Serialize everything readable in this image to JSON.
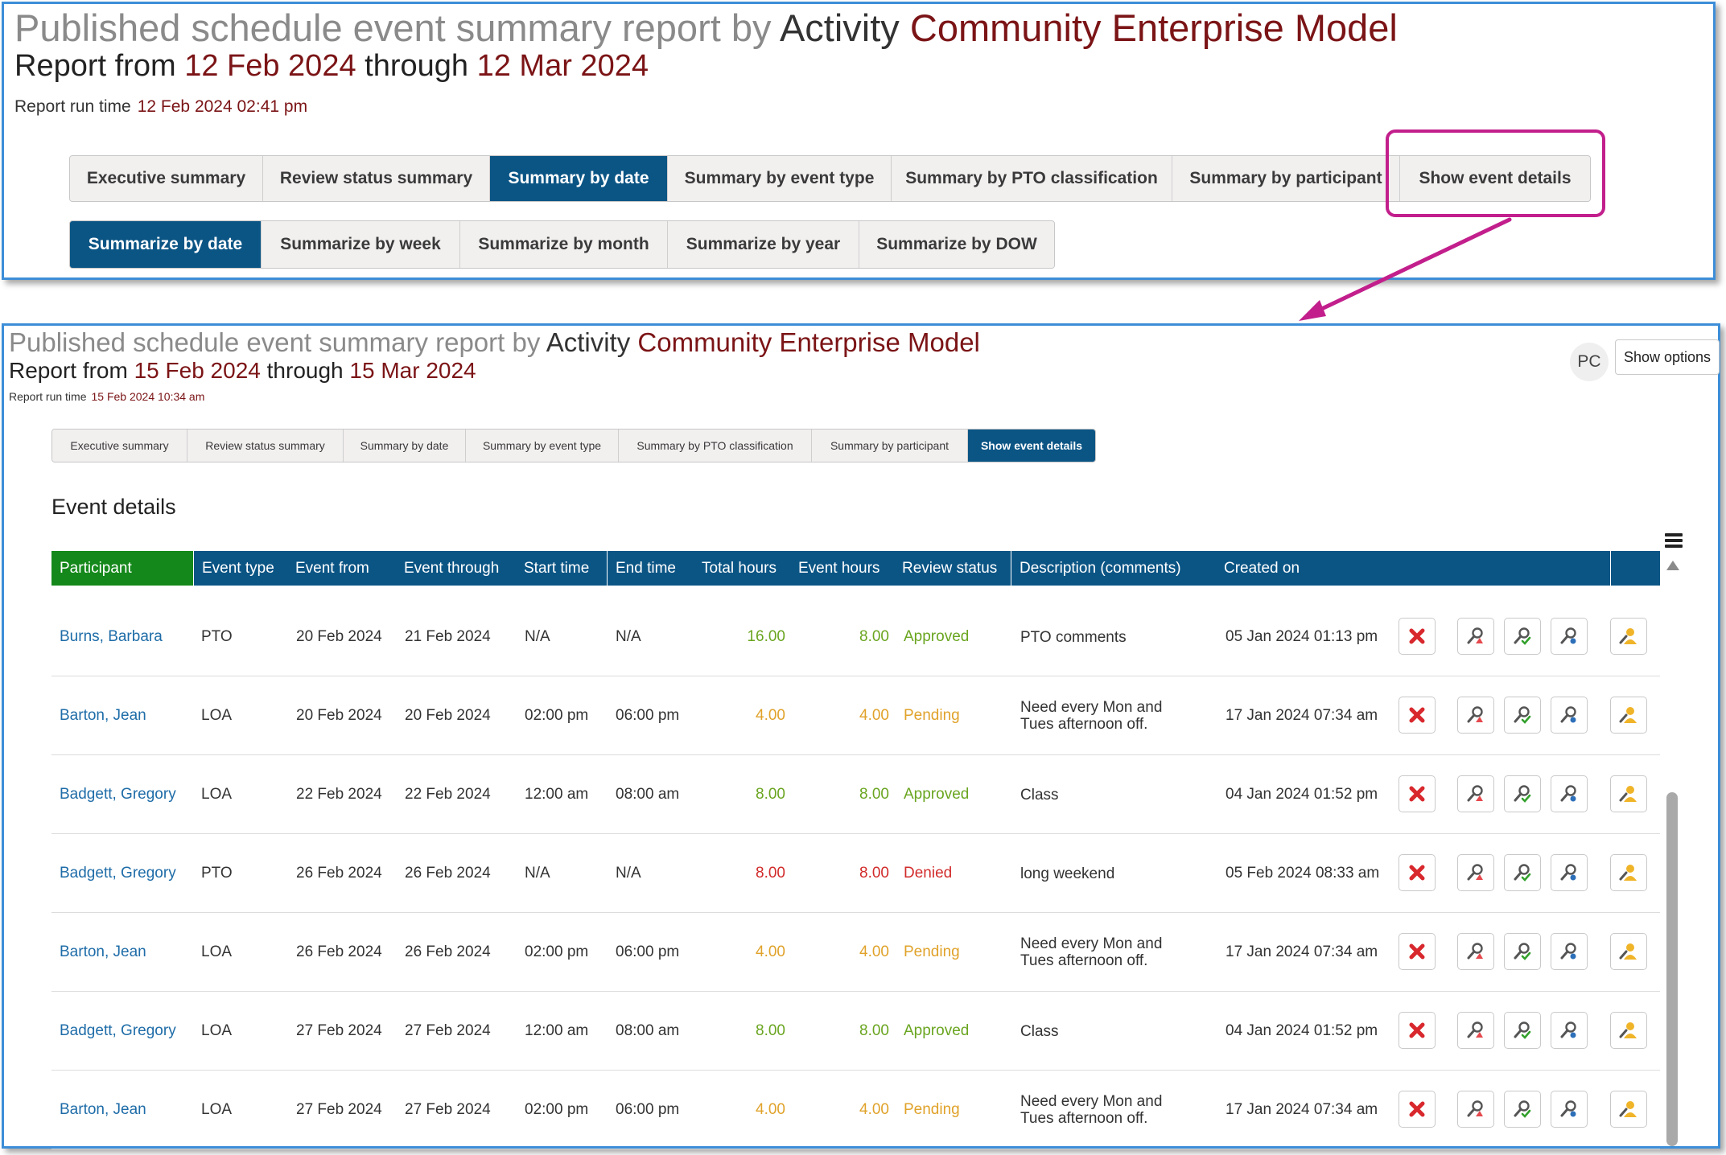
{
  "top": {
    "title_prefix": "Published schedule event summary report by",
    "title_group": "Activity",
    "title_org": "Community Enterprise Model",
    "range_prefix": "Report from",
    "range_from": "12 Feb 2024",
    "range_mid": "through",
    "range_to": "12 Mar 2024",
    "run_label": "Report run time",
    "run_value": "12 Feb 2024 02:41 pm",
    "tabs": [
      {
        "label": "Executive summary",
        "active": false
      },
      {
        "label": "Review status summary",
        "active": false
      },
      {
        "label": "Summary by date",
        "active": true
      },
      {
        "label": "Summary by event type",
        "active": false
      },
      {
        "label": "Summary by PTO classification",
        "active": false
      },
      {
        "label": "Summary by participant",
        "active": false
      },
      {
        "label": "Show event details",
        "active": false
      }
    ],
    "subtabs": [
      {
        "label": "Summarize by date",
        "active": true
      },
      {
        "label": "Summarize by week",
        "active": false
      },
      {
        "label": "Summarize by month",
        "active": false
      },
      {
        "label": "Summarize by year",
        "active": false
      },
      {
        "label": "Summarize by DOW",
        "active": false
      }
    ]
  },
  "bottom": {
    "title_prefix": "Published schedule event summary report by",
    "title_group": "Activity",
    "title_org": "Community Enterprise Model",
    "range_prefix": "Report from",
    "range_from": "15 Feb 2024",
    "range_mid": "through",
    "range_to": "15 Mar 2024",
    "run_label": "Report run time",
    "run_value": "15 Feb 2024 10:34 am",
    "avatar_initials": "PC",
    "show_options_label": "Show options",
    "tabs": [
      {
        "label": "Executive summary",
        "active": false
      },
      {
        "label": "Review status summary",
        "active": false
      },
      {
        "label": "Summary by date",
        "active": false
      },
      {
        "label": "Summary by event type",
        "active": false
      },
      {
        "label": "Summary by PTO classification",
        "active": false
      },
      {
        "label": "Summary by participant",
        "active": false
      },
      {
        "label": "Show event details",
        "active": true
      }
    ],
    "section_title": "Event details",
    "columns": [
      "Participant",
      "Event type",
      "Event from",
      "Event through",
      "Start time",
      "End time",
      "Total hours",
      "Event hours",
      "Review status",
      "Description (comments)",
      "Created on"
    ],
    "rows": [
      {
        "participant": "Burns, Barbara",
        "event_type": "PTO",
        "event_from": "20 Feb 2024",
        "event_through": "21 Feb 2024",
        "start_time": "N/A",
        "end_time": "N/A",
        "total_hours": "16.00",
        "event_hours": "8.00",
        "review_status": "Approved",
        "description": "PTO comments",
        "created_on": "05 Jan 2024 01:13 pm"
      },
      {
        "participant": "Barton, Jean",
        "event_type": "LOA",
        "event_from": "20 Feb 2024",
        "event_through": "20 Feb 2024",
        "start_time": "02:00 pm",
        "end_time": "06:00 pm",
        "total_hours": "4.00",
        "event_hours": "4.00",
        "review_status": "Pending",
        "description": "Need every Mon and Tues afternoon off.",
        "created_on": "17 Jan 2024 07:34 am"
      },
      {
        "participant": "Badgett, Gregory",
        "event_type": "LOA",
        "event_from": "22 Feb 2024",
        "event_through": "22 Feb 2024",
        "start_time": "12:00 am",
        "end_time": "08:00 am",
        "total_hours": "8.00",
        "event_hours": "8.00",
        "review_status": "Approved",
        "description": "Class",
        "created_on": "04 Jan 2024 01:52 pm"
      },
      {
        "participant": "Badgett, Gregory",
        "event_type": "PTO",
        "event_from": "26 Feb 2024",
        "event_through": "26 Feb 2024",
        "start_time": "N/A",
        "end_time": "N/A",
        "total_hours": "8.00",
        "event_hours": "8.00",
        "review_status": "Denied",
        "description": "long weekend",
        "created_on": "05 Feb 2024 08:33 am"
      },
      {
        "participant": "Barton, Jean",
        "event_type": "LOA",
        "event_from": "26 Feb 2024",
        "event_through": "26 Feb 2024",
        "start_time": "02:00 pm",
        "end_time": "06:00 pm",
        "total_hours": "4.00",
        "event_hours": "4.00",
        "review_status": "Pending",
        "description": "Need every Mon and Tues afternoon off.",
        "created_on": "17 Jan 2024 07:34 am"
      },
      {
        "participant": "Badgett, Gregory",
        "event_type": "LOA",
        "event_from": "27 Feb 2024",
        "event_through": "27 Feb 2024",
        "start_time": "12:00 am",
        "end_time": "08:00 am",
        "total_hours": "8.00",
        "event_hours": "8.00",
        "review_status": "Approved",
        "description": "Class",
        "created_on": "04 Jan 2024 01:52 pm"
      },
      {
        "participant": "Barton, Jean",
        "event_type": "LOA",
        "event_from": "27 Feb 2024",
        "event_through": "27 Feb 2024",
        "start_time": "02:00 pm",
        "end_time": "06:00 pm",
        "total_hours": "4.00",
        "event_hours": "4.00",
        "review_status": "Pending",
        "description": "Need every Mon and Tues afternoon off.",
        "created_on": "17 Jan 2024 07:34 am"
      }
    ],
    "row_actions": [
      "delete-icon",
      "review-red-icon",
      "review-green-icon",
      "review-blue-icon",
      "edit-participant-icon"
    ]
  },
  "colors": {
    "header_blue": "#0b5585",
    "participant_header_green": "#14881a",
    "maroon": "#7b1416",
    "approved": "#6aa520",
    "pending": "#e0a22a",
    "denied": "#d22b2b",
    "link": "#1e6ca8",
    "highlight": "#c21f8c"
  }
}
